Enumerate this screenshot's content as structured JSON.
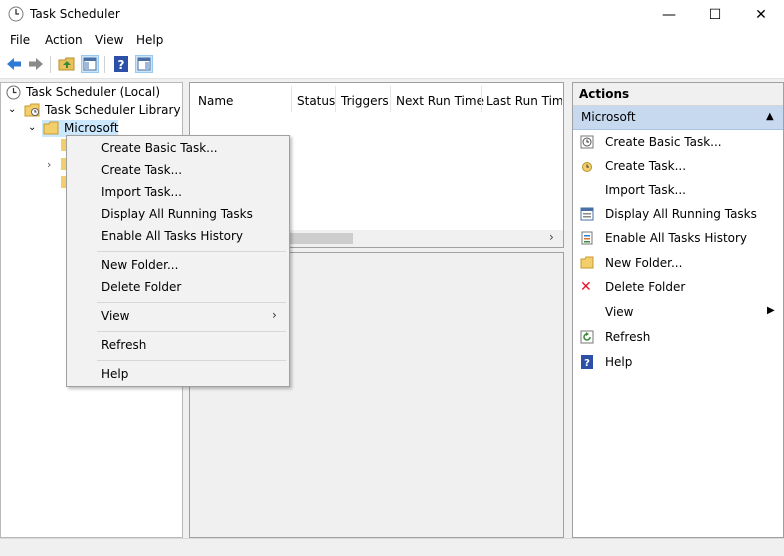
{
  "window": {
    "title": "Task Scheduler",
    "controls": [
      "—",
      "☐",
      "✕"
    ]
  },
  "menubar": [
    "File",
    "Action",
    "View",
    "Help"
  ],
  "tree": {
    "root": "Task Scheduler (Local)",
    "library": "Task Scheduler Library",
    "selected": "Microsoft"
  },
  "columns": [
    "Name",
    "Status",
    "Triggers",
    "Next Run Time",
    "Last Run Time"
  ],
  "actions": {
    "title": "Actions",
    "group": "Microsoft",
    "items": [
      "Create Basic Task...",
      "Create Task...",
      "Import Task...",
      "Display All Running Tasks",
      "Enable All Tasks History",
      "New Folder...",
      "Delete Folder",
      "View",
      "Refresh",
      "Help"
    ]
  },
  "context_menu": [
    "Create Basic Task...",
    "Create Task...",
    "Import Task...",
    "Display All Running Tasks",
    "Enable All Tasks History",
    "New Folder...",
    "Delete Folder",
    "View",
    "Refresh",
    "Help"
  ],
  "colors": {
    "selection": "#cce8ff",
    "actions_group": "#c7d9ee",
    "delete_red": "#e81123"
  }
}
